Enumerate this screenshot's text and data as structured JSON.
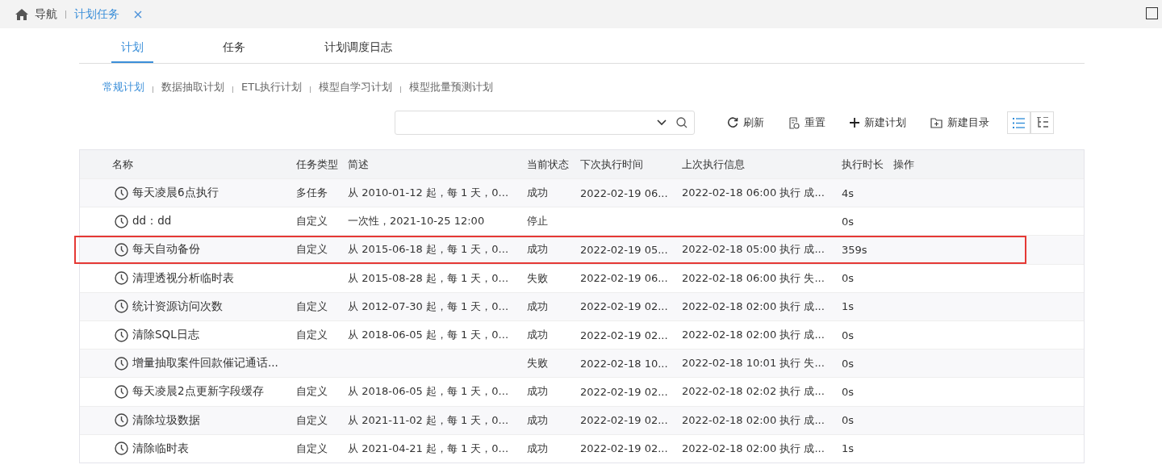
{
  "top_tabs": [
    {
      "label": "导航",
      "kind": "home",
      "selected": false
    },
    {
      "label": "计划任务",
      "kind": "page",
      "selected": true
    }
  ],
  "tabs": [
    {
      "label": "计划",
      "selected": true
    },
    {
      "label": "任务",
      "selected": false
    },
    {
      "label": "计划调度日志",
      "selected": false
    }
  ],
  "subtabs": [
    {
      "label": "常规计划",
      "selected": true
    },
    {
      "label": "数据抽取计划",
      "selected": false
    },
    {
      "label": "ETL执行计划",
      "selected": false
    },
    {
      "label": "模型自学习计划",
      "selected": false
    },
    {
      "label": "模型批量预测计划",
      "selected": false
    }
  ],
  "toolbar": [
    {
      "label": "刷新",
      "kind": "refresh"
    },
    {
      "label": "重置",
      "kind": "reset"
    },
    {
      "label": "新建计划",
      "kind": "add"
    },
    {
      "label": "新建目录",
      "kind": "folder"
    }
  ],
  "view_toggle": [
    {
      "kind": "list",
      "selected": true
    },
    {
      "kind": "tree",
      "selected": false
    }
  ],
  "table": {
    "columns": [
      "名称",
      "任务类型",
      "简述",
      "当前状态",
      "下次执行时间",
      "上次执行信息",
      "执行时长",
      "操作"
    ],
    "rows": [
      {
        "name": "每天凌晨6点执行",
        "type": "多任务",
        "desc": "从 2010-01-12 起，每 1 天，0...",
        "status": "成功",
        "next": "2022-02-19 06...",
        "last": "2022-02-18 06:00 执行 成...",
        "duration": "4s",
        "highlighted": false
      },
      {
        "name": "dd：dd",
        "type": "自定义",
        "desc": "一次性，2021-10-25 12:00",
        "status": "停止",
        "next": "",
        "last": "",
        "duration": "0s",
        "highlighted": false
      },
      {
        "name": "每天自动备份",
        "type": "自定义",
        "desc": "从 2015-06-18 起，每 1 天，0...",
        "status": "成功",
        "next": "2022-02-19 05...",
        "last": "2022-02-18 05:00 执行 成...",
        "duration": "359s",
        "highlighted": true
      },
      {
        "name": "清理透视分析临时表",
        "type": "",
        "desc": "从 2015-08-28 起，每 1 天，0...",
        "status": "失败",
        "next": "2022-02-19 06...",
        "last": "2022-02-18 06:00 执行 失...",
        "duration": "0s",
        "highlighted": false
      },
      {
        "name": "统计资源访问次数",
        "type": "自定义",
        "desc": "从 2012-07-30 起，每 1 天，0...",
        "status": "成功",
        "next": "2022-02-19 02...",
        "last": "2022-02-18 02:00 执行 成...",
        "duration": "1s",
        "highlighted": false
      },
      {
        "name": "清除SQL日志",
        "type": "自定义",
        "desc": "从 2018-06-05 起，每 1 天，0...",
        "status": "成功",
        "next": "2022-02-19 02...",
        "last": "2022-02-18 02:00 执行 成...",
        "duration": "0s",
        "highlighted": false
      },
      {
        "name": "增量抽取案件回款催记通话...",
        "type": "",
        "desc": "",
        "status": "失败",
        "next": "2022-02-18 10...",
        "last": "2022-02-18 10:01 执行 失...",
        "duration": "0s",
        "highlighted": false
      },
      {
        "name": "每天凌晨2点更新字段缓存",
        "type": "自定义",
        "desc": "从 2018-06-05 起，每 1 天，0...",
        "status": "成功",
        "next": "2022-02-19 02...",
        "last": "2022-02-18 02:02 执行 成...",
        "duration": "0s",
        "highlighted": false
      },
      {
        "name": "清除垃圾数据",
        "type": "自定义",
        "desc": "从 2021-11-02 起，每 1 天，0...",
        "status": "成功",
        "next": "2022-02-19 02...",
        "last": "2022-02-18 02:00 执行 成...",
        "duration": "0s",
        "highlighted": false
      },
      {
        "name": "清除临时表",
        "type": "自定义",
        "desc": "从 2021-04-21 起，每 1 天，0...",
        "status": "成功",
        "next": "2022-02-19 02...",
        "last": "2022-02-18 02:00 执行 成...",
        "duration": "1s",
        "highlighted": false
      }
    ]
  }
}
